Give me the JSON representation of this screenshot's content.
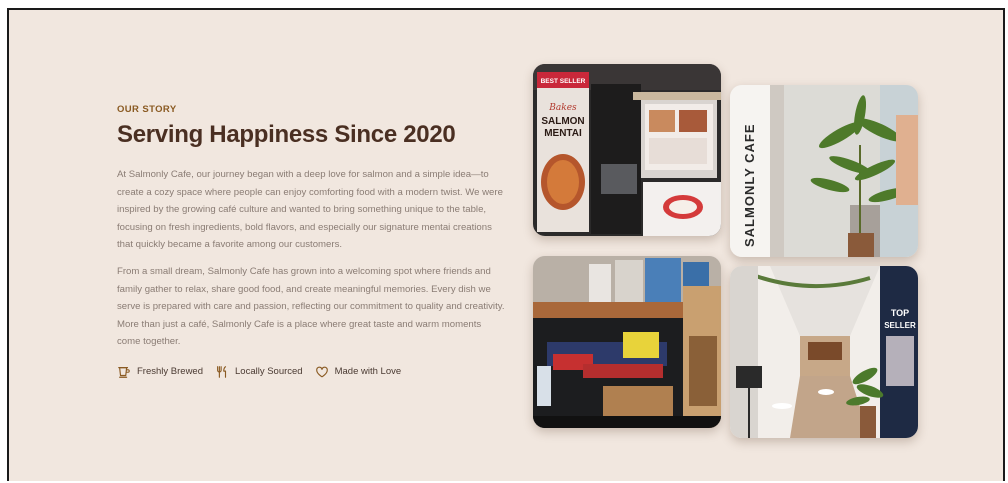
{
  "story": {
    "eyebrow": "OUR STORY",
    "title": "Serving Happiness Since 2020",
    "paragraphs": [
      "At Salmonly Cafe, our journey began with a deep love for salmon and a simple idea—to create a cozy space where people can enjoy comforting food with a modern twist. We were inspired by the growing café culture and wanted to bring something unique to the table, focusing on fresh ingredients, bold flavors, and especially our signature mentai creations that quickly became a favorite among our customers.",
      "From a small dream, Salmonly Cafe has grown into a welcoming spot where friends and family gather to relax, share good food, and create meaningful memories. Every dish we serve is prepared with care and passion, reflecting our commitment to quality and creativity. More than just a café, Salmonly Cafe is a place where great taste and warm moments come together."
    ],
    "features": [
      {
        "icon": "coffee-cup-icon",
        "label": "Freshly Brewed"
      },
      {
        "icon": "fork-knife-icon",
        "label": "Locally Sourced"
      },
      {
        "icon": "heart-icon",
        "label": "Made with Love"
      }
    ]
  },
  "photos": {
    "photo1": {
      "badge": "BEST SELLER",
      "script": "Bakes",
      "line1": "SALMON",
      "line2": "MENTAI"
    },
    "photo2": {
      "sign": "SALMONLY CAFE"
    },
    "photo3": {},
    "photo4": {
      "poster_line1": "TOP",
      "poster_line2": "SELLER"
    }
  },
  "colors": {
    "background": "#f1e7df",
    "title": "#4a2f22",
    "eyebrow": "#8a5a22",
    "body_text": "#8a7c74",
    "icon": "#8a5a22"
  }
}
